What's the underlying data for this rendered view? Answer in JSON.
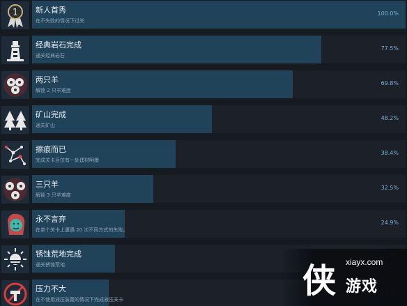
{
  "achievements": [
    {
      "title": "新人首秀",
      "desc": "在不失败的情况下过关",
      "pct": "100.0%",
      "fill": 1.0,
      "icon": "medal-icon"
    },
    {
      "title": "经典岩石完成",
      "desc": "通关经典岩石",
      "pct": "77.5%",
      "fill": 0.775,
      "icon": "lighthouse-icon"
    },
    {
      "title": "两只羊",
      "desc": "解锁 2 只羊难度",
      "pct": "69.8%",
      "fill": 0.698,
      "icon": "two-sheep-icon"
    },
    {
      "title": "矿山完成",
      "desc": "通关矿山",
      "pct": "48.2%",
      "fill": 0.482,
      "icon": "pine-trees-icon"
    },
    {
      "title": "擦痕而已",
      "desc": "完成关卡且仅有一处建材明爆",
      "pct": "38.4%",
      "fill": 0.384,
      "icon": "constellation-icon"
    },
    {
      "title": "三只羊",
      "desc": "解锁 3 只羊难度",
      "pct": "32.5%",
      "fill": 0.325,
      "icon": "three-sheep-icon"
    },
    {
      "title": "永不言弃",
      "desc": "在单个关卡上遭遇 20 次不同方式的失败。",
      "pct": "24.9%",
      "fill": 0.249,
      "icon": "face-icon"
    },
    {
      "title": "锈蚀荒地完成",
      "desc": "通关锈蚀荒地",
      "pct": "22.2%",
      "fill": 0.222,
      "icon": "sun-icon"
    },
    {
      "title": "压力不大",
      "desc": "在不使用液压装置的情况下完成液压关卡",
      "pct": "20.5%",
      "fill": 0.205,
      "icon": "no-hydraulics-icon"
    }
  ],
  "watermark": {
    "char": "侠",
    "url": "xiayx.com",
    "name": "游戏"
  }
}
